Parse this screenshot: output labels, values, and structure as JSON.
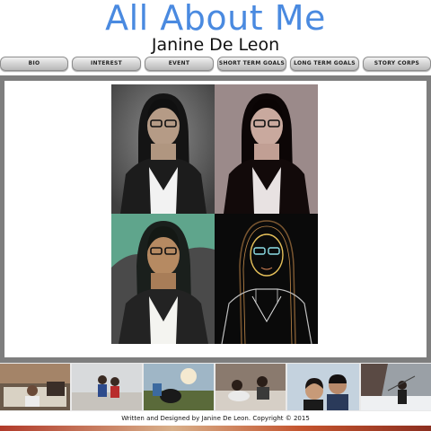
{
  "header": {
    "title": "All About Me",
    "subtitle": "Janine De Leon"
  },
  "nav": {
    "items": [
      {
        "label": "BIO"
      },
      {
        "label": "INTEREST"
      },
      {
        "label": "EVENT"
      },
      {
        "label": "SHORT TERM GOALS"
      },
      {
        "label": "LONG TERM GOALS"
      },
      {
        "label": "STORY CORPS"
      }
    ]
  },
  "main": {
    "portraits": [
      {
        "style": "grayscale-studio"
      },
      {
        "style": "sepia-tint"
      },
      {
        "style": "teal-color-filter"
      },
      {
        "style": "neon-edge-filter"
      }
    ]
  },
  "gallery": {
    "count": 6
  },
  "footer": {
    "text": "Written and Designed by Janine De Leon. Copyright © 2015"
  },
  "colors": {
    "title": "#4a8ae0",
    "frame": "#7e7e7e",
    "nav_button": "#d0d0d0"
  }
}
